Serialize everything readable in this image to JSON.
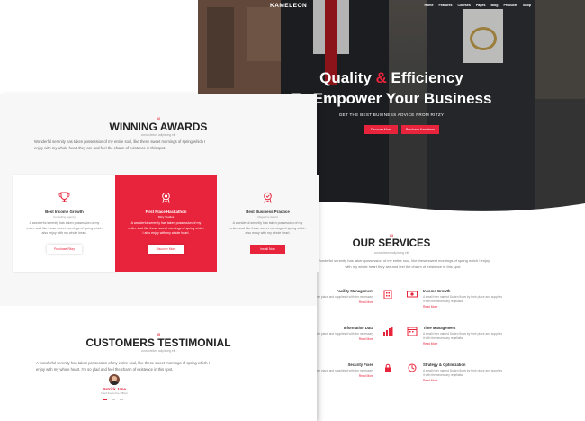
{
  "colors": {
    "accent": "#e8243c",
    "hero_bg": "#3a3c3b",
    "text_dark": "#222222"
  },
  "nav": {
    "logo": "KAMELEON",
    "links": [
      "Home",
      "Features",
      "Courses",
      "Pages",
      "Blog",
      "Products",
      "Shop"
    ]
  },
  "hero": {
    "title_part1": "Quality ",
    "title_amp": "&",
    "title_part2": " Efficiency",
    "title_line2": "To Empower Your Business",
    "subtitle": "GET THE BEST BUSINESS ADVICE FROM RITZY",
    "button1": "Discover More",
    "button2": "Purchase Kameleon"
  },
  "services": {
    "tag": "03",
    "title": "OUR SERVICES",
    "tagline": "consectetuer adipiscing elit",
    "description": "Wonderful serenity has taken possession of my entire soul, like these sweet mornings of spring which I enjoy with my whole heart they are and feel the charm of existence in this spot.",
    "items": [
      {
        "title": "Facility Management",
        "desc": "Flows by their place and supplies it with the necessary",
        "more": "Read More",
        "icon": "building-icon"
      },
      {
        "title": "Income Growth",
        "desc": "A small river named Duden flows by their place and supplies it with the necessary regelialia",
        "more": "Read More",
        "icon": "money-icon"
      },
      {
        "title": "Information Data",
        "desc": "Flows by their place and supplies it with the necessary",
        "more": "Read More",
        "icon": "chart-icon"
      },
      {
        "title": "Time Management",
        "desc": "A small river named Duden flows by their place and supplies it with the necessary regelialia",
        "more": "Read More",
        "icon": "calendar-icon"
      },
      {
        "title": "Security Fixes",
        "desc": "Flows by their place and supplies it with the necessary",
        "more": "Read More",
        "icon": "lock-icon"
      },
      {
        "title": "Strategy & Optimization",
        "desc": "A small river named Duden flows by their place and supplies it with the necessary regelialia",
        "more": "Read More",
        "icon": "strategy-icon"
      }
    ]
  },
  "awards": {
    "tag": "02",
    "title": "WINNING AWARDS",
    "tagline": "consectetuer adipiscing elit",
    "description": "Wonderful serenity has taken possession of my entire soul, like these sweet mornings of spring which I enjoy with my whole heart they are and feel the charm of existence in this spot.",
    "cards": [
      {
        "title": "Best Income Growth",
        "subtitle": "Consulting Agency",
        "desc": "A wonderful serenity has taken possession of my entire soul like these sweet mornings of spring which also enjoy with my whole heart.",
        "button": "Purchase Ritzy"
      },
      {
        "title": "First Place Hackathon",
        "subtitle": "Ritzy Studios",
        "desc": "A wonderful serenity has taken possession of my entire soul like these sweet mornings of spring which I also enjoy with my whole heart.",
        "button": "Discover More"
      },
      {
        "title": "Best Business Practice",
        "subtitle": "Magazine Award",
        "desc": "A wonderful serenity has taken possession of my entire soul like these sweet mornings of spring which also enjoy with my whole heart.",
        "button": "Install Now"
      }
    ]
  },
  "testimonial": {
    "tag": "05",
    "title": "CUSTOMERS TESTIMONIAL",
    "tagline": "consectetuer adipiscing elit",
    "quote": "A wonderful serenity has taken possession of my entire soul, like these sweet mornings of spring which I enjoy with my whole heart. I'm so glad and feel the charm of existence in this spot.",
    "name": "Patrick Jane",
    "role": "Chief Executive Officer"
  }
}
